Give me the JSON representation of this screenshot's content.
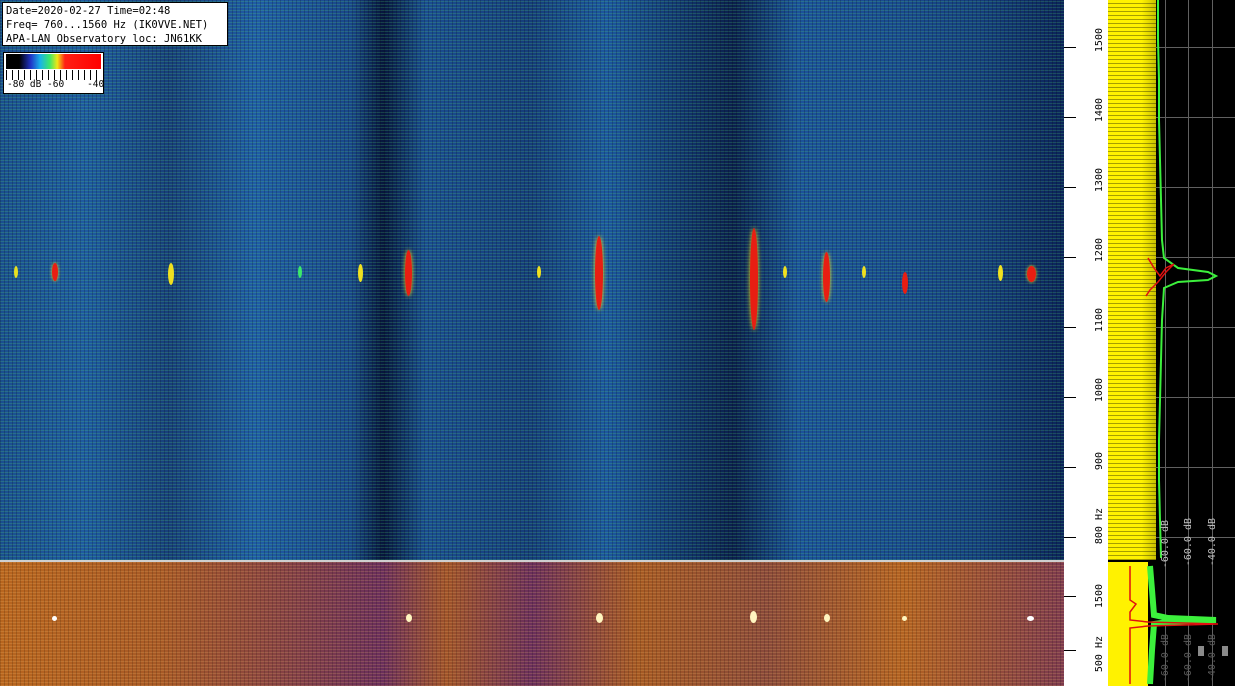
{
  "info": {
    "line1": "Date=2020-02-27 Time=02:48",
    "line2": "Freq= 760...1560 Hz (IK0VVE.NET)",
    "line3": "APA-LAN Observatory loc: JN61KK"
  },
  "legend": {
    "labels": "-80 dB -60    -40",
    "gradient_colors": [
      "#000000",
      "#2034c8",
      "#19b3e8",
      "#3ce86a",
      "#f0e614",
      "#ff1f14"
    ]
  },
  "freq_axis_top": {
    "labels": [
      "1500",
      "1400",
      "1300",
      "1200",
      "1100",
      "1000",
      "900",
      "800 Hz"
    ]
  },
  "freq_axis_bottom": {
    "labels": [
      "1500",
      "500 Hz"
    ]
  },
  "spectrum_top": {
    "db_labels": [
      "-60.0 dB",
      "-60.0 dB",
      "-40.0 dB"
    ]
  },
  "spectrum_bottom": {
    "db_labels": [
      "-60.0 dB",
      "-60.0 dB",
      "-40.0 dB"
    ]
  },
  "colors": {
    "waterfall_top_base": "#1b4f8f",
    "waterfall_bottom_base": "#b8661f",
    "spectrum_yellow": "#fff200",
    "spectrum_green": "#3cf03c",
    "spectrum_red": "#e01010"
  }
}
